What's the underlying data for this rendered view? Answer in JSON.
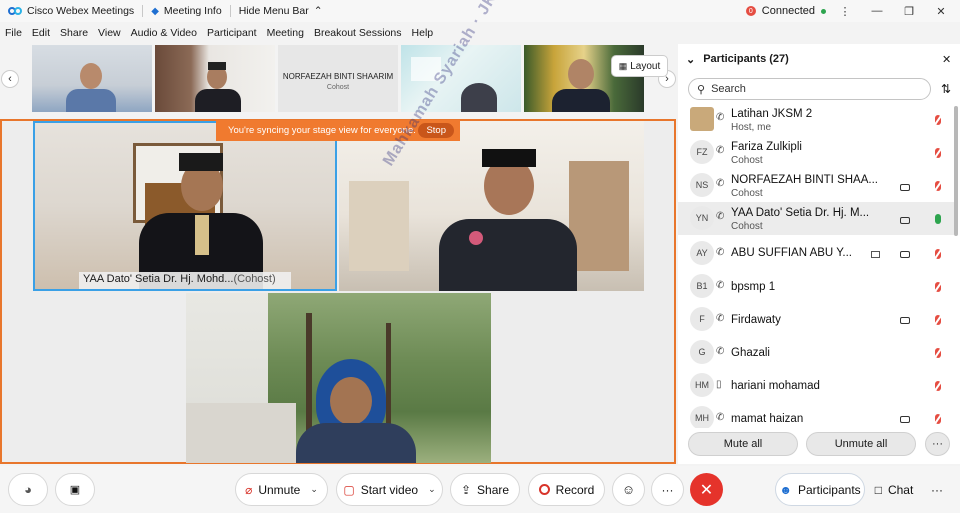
{
  "titlebar": {
    "app_title": "Cisco Webex Meetings",
    "meeting_info": "Meeting Info",
    "hide_menu": "Hide Menu Bar",
    "connected": "Connected",
    "conn_badge": "0"
  },
  "menu": [
    "File",
    "Edit",
    "Share",
    "View",
    "Audio & Video",
    "Participant",
    "Meeting",
    "Breakout Sessions",
    "Help"
  ],
  "filmstrip": {
    "thumb_name": "NORFAEZAH BINTI SHAARIM",
    "thumb_role": "Cohost",
    "layout_label": "Layout"
  },
  "stage": {
    "sync_text": "You're syncing your stage view for everyone.",
    "stop_label": "Stop",
    "active_name": "YAA Dato' Setia Dr. Hj. Mohd...",
    "active_role": "(Cohost)",
    "watermark": "Mahkamah Syariah · JKSM"
  },
  "participants": {
    "title": "Participants (27)",
    "search_placeholder": "Search",
    "list": [
      {
        "initials": "",
        "name": "Latihan JKSM 2",
        "role": "Host, me",
        "mic": "muted",
        "video": false,
        "share": false
      },
      {
        "initials": "FZ",
        "name": "Fariza Zulkipli",
        "role": "Cohost",
        "mic": "muted",
        "video": false,
        "share": false
      },
      {
        "initials": "NS",
        "name": "NORFAEZAH BINTI SHAA...",
        "role": "Cohost",
        "mic": "muted",
        "video": true,
        "share": false
      },
      {
        "initials": "YN",
        "name": "YAA Dato' Setia Dr. Hj. M...",
        "role": "Cohost",
        "mic": "on",
        "video": true,
        "share": false
      },
      {
        "initials": "AY",
        "name": "ABU SUFFIAN ABU Y...",
        "role": "",
        "mic": "muted",
        "video": true,
        "share": true
      },
      {
        "initials": "B1",
        "name": "bpsmp 1",
        "role": "",
        "mic": "muted",
        "video": false,
        "share": false
      },
      {
        "initials": "F",
        "name": "Firdawaty",
        "role": "",
        "mic": "muted",
        "video": true,
        "share": false
      },
      {
        "initials": "G",
        "name": "Ghazali",
        "role": "",
        "mic": "muted",
        "video": false,
        "share": false
      },
      {
        "initials": "HM",
        "name": "hariani mohamad",
        "role": "",
        "mic": "muted",
        "video": false,
        "share": false
      },
      {
        "initials": "MH",
        "name": "mamat haizan",
        "role": "",
        "mic": "muted",
        "video": true,
        "share": false
      }
    ],
    "mute_all": "Mute all",
    "unmute_all": "Unmute all",
    "more": "···"
  },
  "toolbar": {
    "unmute": "Unmute",
    "start_video": "Start video",
    "share": "Share",
    "record": "Record",
    "more": "···",
    "participants": "Participants",
    "chat": "Chat",
    "more2": "···"
  },
  "colors": {
    "accent_orange": "#e8762c",
    "end_red": "#e5332b",
    "active_blue": "#3aa0e6"
  }
}
